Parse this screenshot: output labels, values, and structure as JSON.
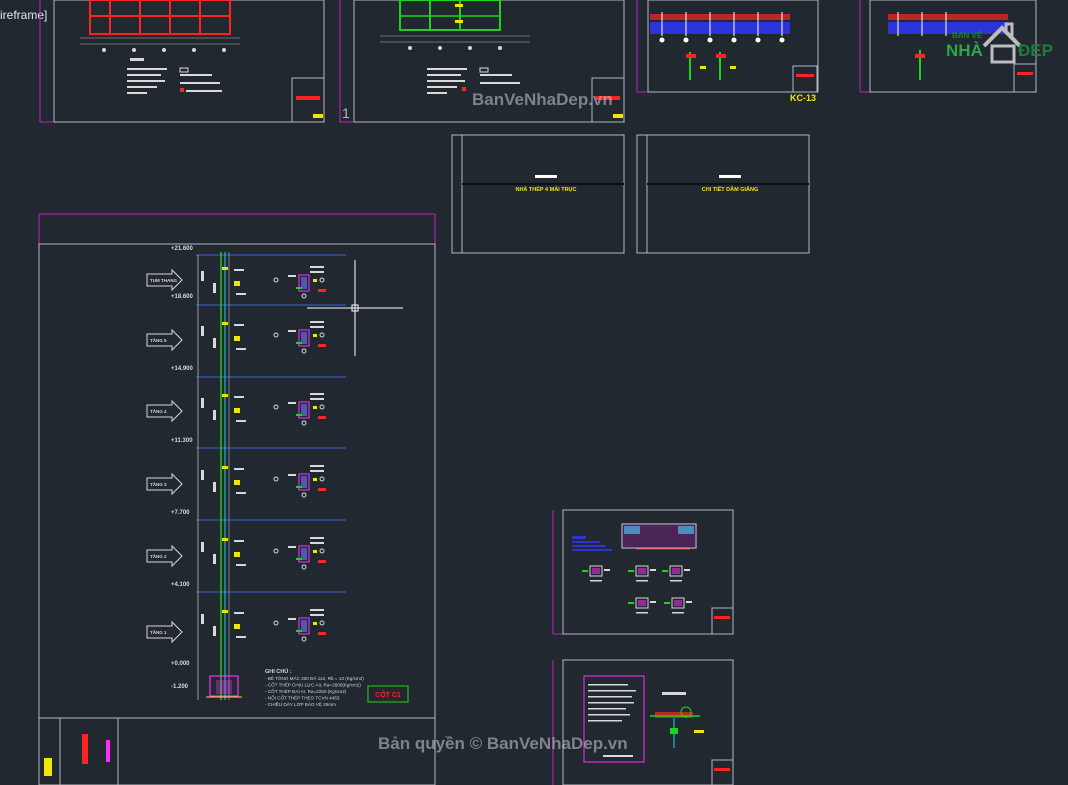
{
  "viewport": {
    "label": "ireframe]"
  },
  "sheets": {
    "kc13_label": "KC-13",
    "section_title_a": "NHÀ THÉP 4 MÁI TRỤC",
    "section_title_b": "CHI TIẾT DẦM GIẰNG",
    "column_label": "CỘT C1",
    "floor_arrows": [
      "TUM THANG",
      "TẦNG 5",
      "TẦNG 4",
      "TẦNG 3",
      "TẦNG 2",
      "TẦNG 1"
    ],
    "elevations": [
      "+21.600",
      "+18.600",
      "+14.900",
      "+11.300",
      "+7.700",
      "+4.100",
      "+0.000",
      "-1.200"
    ],
    "notes_title": "GHI CHÚ :",
    "notes_lines": [
      "- BÊ TÔNG MÁC 300 ĐÁ 1x2, Rb = 13 (Kg/cm2)",
      "- CỐT THÉP CHỊU LỰC AII, Ra=2800(Kg/cm2)",
      "- CỐT THÉP ĐAI AI, Ra=2250 (Kg/cm2)",
      "- NỐI CỐT THÉP THEO TCVN 4453",
      "- CHIỀU DÀY LỚP BẢO VỆ 25mm"
    ]
  },
  "watermark": {
    "top": "BanVeNhaDep.vn",
    "bottom": "Bản quyền © BanVeNhaDep.vn"
  },
  "logo": {
    "small": "BẢN VẼ",
    "big_a": "NHÀ",
    "big_b": "ĐẸP"
  },
  "colors": {
    "background": "#212830",
    "sheet_border": "#b2b8be",
    "layout_frame": "#c21fc2",
    "rebar": "#ffffff",
    "accent_yellow": "#f2e600",
    "accent_red": "#ff2222",
    "accent_green": "#1fd21f",
    "accent_cyan": "#1fd4e0",
    "accent_magenta": "#ff2dff"
  }
}
